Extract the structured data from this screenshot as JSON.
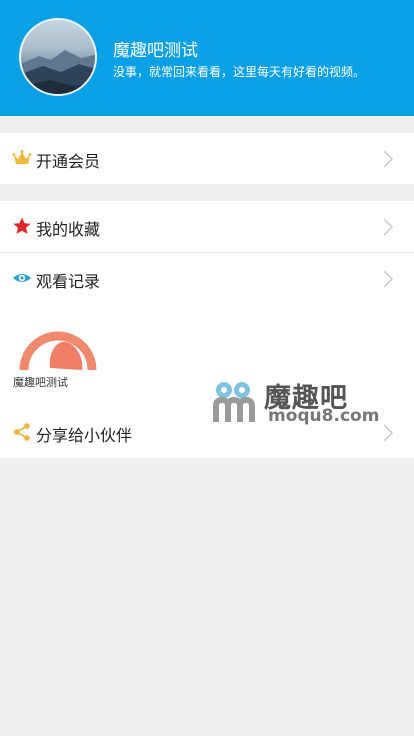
{
  "profile": {
    "name": "魔趣吧测试",
    "motto": "没事，就常回来看看，这里每天有好看的视频。"
  },
  "menu": {
    "vip": "开通会员",
    "favorites": "我的收藏",
    "history": "观看记录",
    "share": "分享给小伙伴"
  },
  "share_preview": {
    "caption": "魔趣吧测试"
  },
  "watermark": {
    "title": "魔趣吧",
    "url": "moqu8.com"
  },
  "colors": {
    "header": "#0aa0e6",
    "crown": "#f0b73a",
    "star": "#e0262b",
    "eye": "#2aa2d8",
    "share": "#f2b33d"
  },
  "icons": [
    "crown-icon",
    "star-icon",
    "eye-icon",
    "share-icon",
    "chevron-right-icon"
  ]
}
